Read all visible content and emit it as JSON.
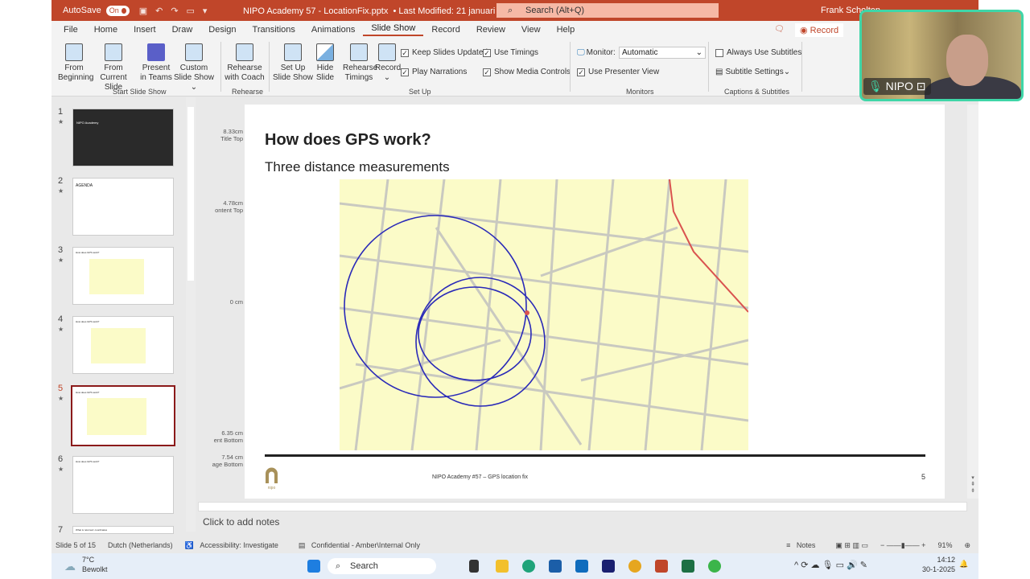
{
  "titlebar": {
    "autosave": "AutoSave",
    "autosave_state": "On",
    "document": "NIPO Academy 57 - LocationFix.pptx",
    "modified": "• Last Modified: 21 januari",
    "search_placeholder": "Search (Alt+Q)",
    "user": "Frank Scholten"
  },
  "menu": [
    "File",
    "Home",
    "Insert",
    "Draw",
    "Design",
    "Transitions",
    "Animations",
    "Slide Show",
    "Record",
    "Review",
    "View",
    "Help"
  ],
  "menu_active": "Slide Show",
  "record_button": "Record",
  "ribbon": {
    "from_beginning": "From Beginning",
    "from_current": "From Current Slide",
    "present_teams": "Present in Teams",
    "custom_show": "Custom Slide Show",
    "group_start": "Start Slide Show",
    "rehearse_coach": "Rehearse with Coach",
    "group_rehearse": "Rehearse",
    "set_up": "Set Up Slide Show",
    "hide_slide": "Hide Slide",
    "rehearse_timings": "Rehearse Timings",
    "record": "Record",
    "keep_updated": "Keep Slides Updated",
    "use_timings": "Use Timings",
    "play_narrations": "Play Narrations",
    "show_media": "Show Media Controls",
    "group_setup": "Set Up",
    "monitor_label": "Monitor:",
    "monitor_value": "Automatic",
    "presenter_view": "Use Presenter View",
    "group_monitors": "Monitors",
    "always_subtitles": "Always Use Subtitles",
    "subtitle_settings": "Subtitle Settings",
    "group_captions": "Captions & Subtitles"
  },
  "thumbnails": [
    {
      "num": "1",
      "text": "NIPO Academy"
    },
    {
      "num": "2",
      "text": "AGENDA"
    },
    {
      "num": "3",
      "text": "How does GPS work?"
    },
    {
      "num": "4",
      "text": "How does GPS work?"
    },
    {
      "num": "5",
      "text": "How does GPS work?"
    },
    {
      "num": "6",
      "text": "How does GPS work?"
    },
    {
      "num": "7",
      "text": "What is returned: coordinates"
    }
  ],
  "guides": [
    {
      "value": "8.33cm",
      "label": "Title Top"
    },
    {
      "value": "4.78cm",
      "label": "ontent Top"
    },
    {
      "value": "0 cm",
      "label": ""
    },
    {
      "value": "6.35 cm",
      "label": "ent Bottom"
    },
    {
      "value": "7.54 cm",
      "label": "age Bottom"
    }
  ],
  "slide": {
    "title": "How does GPS work?",
    "subtitle": "Three distance measurements",
    "footer": "NIPO Academy #57 – GPS location fix",
    "number": "5",
    "logo_text": "nipo"
  },
  "notes_placeholder": "Click to add notes",
  "status": {
    "slide": "Slide 5 of 15",
    "language": "Dutch (Netherlands)",
    "accessibility": "Accessibility: Investigate",
    "sensitivity": "Confidential - Amber\\Internal Only",
    "notes": "Notes",
    "zoom": "91%"
  },
  "taskbar": {
    "temp": "7°C",
    "weather": "Bewolkt",
    "search": "Search",
    "time": "14:12",
    "date": "30-1-2025"
  },
  "webcam": {
    "name": "NIPO"
  },
  "colors": {
    "accent": "#c0462a",
    "circle": "#2a2ab8",
    "map": "#fbfbc8"
  }
}
